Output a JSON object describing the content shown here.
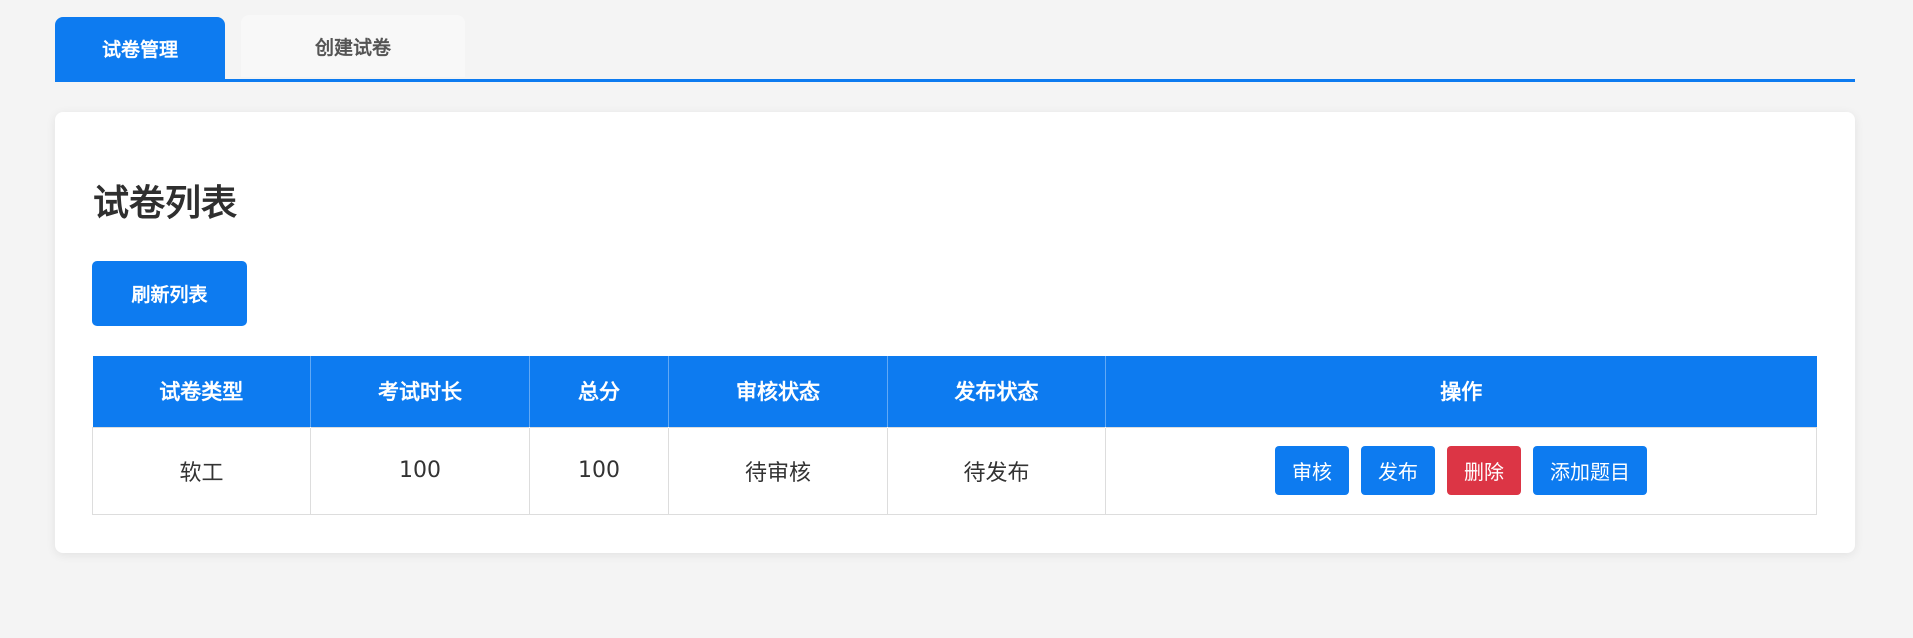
{
  "tabs": [
    {
      "label": "试卷管理",
      "active": true
    },
    {
      "label": "创建试卷",
      "active": false
    }
  ],
  "card": {
    "title": "试卷列表",
    "refresh_label": "刷新列表"
  },
  "table": {
    "headers": [
      "试卷类型",
      "考试时长",
      "总分",
      "审核状态",
      "发布状态",
      "操作"
    ],
    "rows": [
      {
        "type": "软工",
        "duration": "100",
        "total_score": "100",
        "review_status": "待审核",
        "publish_status": "待发布",
        "actions": {
          "review": "审核",
          "publish": "发布",
          "delete": "删除",
          "add_question": "添加题目"
        }
      }
    ]
  },
  "colors": {
    "primary": "#0d7bf0",
    "danger": "#dc3545",
    "background": "#f4f4f4"
  }
}
